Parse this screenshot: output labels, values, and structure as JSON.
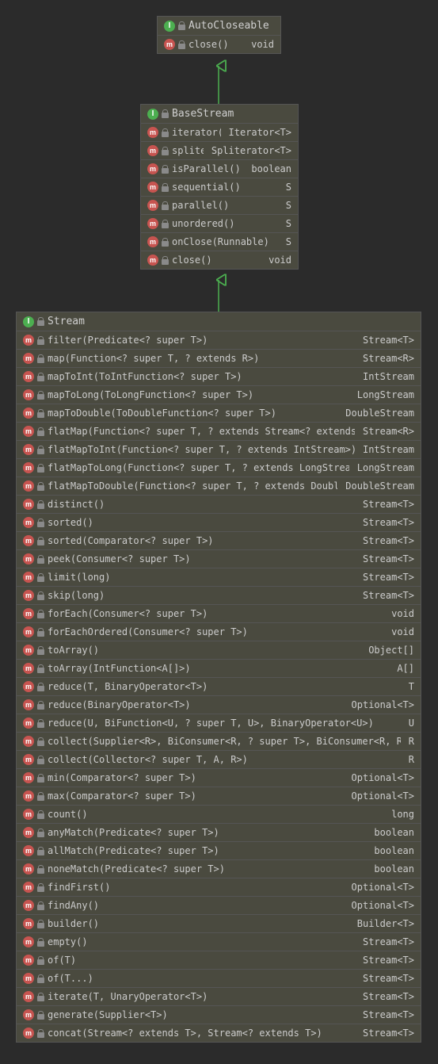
{
  "classes": {
    "autocloseable": {
      "name": "AutoCloseable",
      "methods": [
        {
          "m": "close()",
          "r": "void"
        }
      ]
    },
    "basestream": {
      "name": "BaseStream",
      "methods": [
        {
          "m": "iterator()",
          "r": "Iterator<T>"
        },
        {
          "m": "spliterator()",
          "r": "Spliterator<T>"
        },
        {
          "m": "isParallel()",
          "r": "boolean"
        },
        {
          "m": "sequential()",
          "r": "S"
        },
        {
          "m": "parallel()",
          "r": "S"
        },
        {
          "m": "unordered()",
          "r": "S"
        },
        {
          "m": "onClose(Runnable)",
          "r": "S"
        },
        {
          "m": "close()",
          "r": "void"
        }
      ]
    },
    "stream": {
      "name": "Stream",
      "methods": [
        {
          "m": "filter(Predicate<? super T>)",
          "r": "Stream<T>"
        },
        {
          "m": "map(Function<? super T, ? extends R>)",
          "r": "Stream<R>"
        },
        {
          "m": "mapToInt(ToIntFunction<? super T>)",
          "r": "IntStream"
        },
        {
          "m": "mapToLong(ToLongFunction<? super T>)",
          "r": "LongStream"
        },
        {
          "m": "mapToDouble(ToDoubleFunction<? super T>)",
          "r": "DoubleStream"
        },
        {
          "m": "flatMap(Function<? super T, ? extends Stream<? extends R>>)",
          "r": "Stream<R>"
        },
        {
          "m": "flatMapToInt(Function<? super T, ? extends IntStream>)",
          "r": "IntStream"
        },
        {
          "m": "flatMapToLong(Function<? super T, ? extends LongStream>)",
          "r": "LongStream"
        },
        {
          "m": "flatMapToDouble(Function<? super T, ? extends DoubleStream>)",
          "r": "DoubleStream"
        },
        {
          "m": "distinct()",
          "r": "Stream<T>"
        },
        {
          "m": "sorted()",
          "r": "Stream<T>"
        },
        {
          "m": "sorted(Comparator<? super T>)",
          "r": "Stream<T>"
        },
        {
          "m": "peek(Consumer<? super T>)",
          "r": "Stream<T>"
        },
        {
          "m": "limit(long)",
          "r": "Stream<T>"
        },
        {
          "m": "skip(long)",
          "r": "Stream<T>"
        },
        {
          "m": "forEach(Consumer<? super T>)",
          "r": "void"
        },
        {
          "m": "forEachOrdered(Consumer<? super T>)",
          "r": "void"
        },
        {
          "m": "toArray()",
          "r": "Object[]"
        },
        {
          "m": "toArray(IntFunction<A[]>)",
          "r": "A[]"
        },
        {
          "m": "reduce(T, BinaryOperator<T>)",
          "r": "T"
        },
        {
          "m": "reduce(BinaryOperator<T>)",
          "r": "Optional<T>"
        },
        {
          "m": "reduce(U, BiFunction<U, ? super T, U>, BinaryOperator<U>)",
          "r": "U"
        },
        {
          "m": "collect(Supplier<R>, BiConsumer<R, ? super T>, BiConsumer<R, R>)",
          "r": "R"
        },
        {
          "m": "collect(Collector<? super T, A, R>)",
          "r": "R"
        },
        {
          "m": "min(Comparator<? super T>)",
          "r": "Optional<T>"
        },
        {
          "m": "max(Comparator<? super T>)",
          "r": "Optional<T>"
        },
        {
          "m": "count()",
          "r": "long"
        },
        {
          "m": "anyMatch(Predicate<? super T>)",
          "r": "boolean"
        },
        {
          "m": "allMatch(Predicate<? super T>)",
          "r": "boolean"
        },
        {
          "m": "noneMatch(Predicate<? super T>)",
          "r": "boolean"
        },
        {
          "m": "findFirst()",
          "r": "Optional<T>"
        },
        {
          "m": "findAny()",
          "r": "Optional<T>"
        },
        {
          "m": "builder()",
          "r": "Builder<T>"
        },
        {
          "m": "empty()",
          "r": "Stream<T>"
        },
        {
          "m": "of(T)",
          "r": "Stream<T>"
        },
        {
          "m": "of(T...)",
          "r": "Stream<T>"
        },
        {
          "m": "iterate(T, UnaryOperator<T>)",
          "r": "Stream<T>"
        },
        {
          "m": "generate(Supplier<T>)",
          "r": "Stream<T>"
        },
        {
          "m": "concat(Stream<? extends T>, Stream<? extends T>)",
          "r": "Stream<T>"
        }
      ]
    }
  }
}
